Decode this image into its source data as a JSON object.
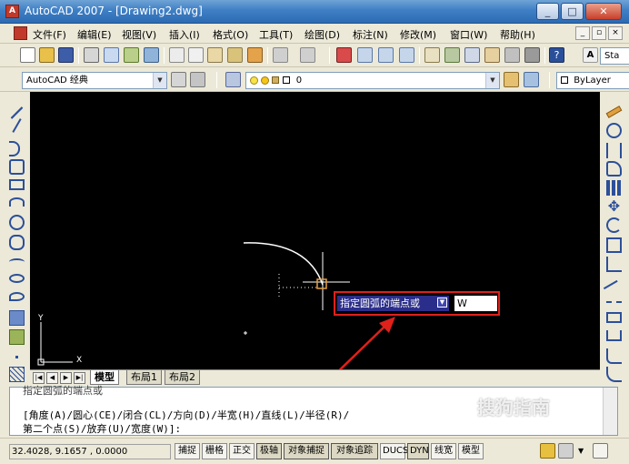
{
  "window": {
    "title": "AutoCAD 2007 - [Drawing2.dwg]",
    "app_icon": "autocad-icon",
    "controls": [
      "_",
      "□",
      "✕"
    ]
  },
  "menu": {
    "items": [
      "文件(F)",
      "编辑(E)",
      "视图(V)",
      "插入(I)",
      "格式(O)",
      "工具(T)",
      "绘图(D)",
      "标注(N)",
      "修改(M)",
      "窗口(W)",
      "帮助(H)"
    ],
    "doc_controls": [
      "_",
      "▫",
      "×"
    ]
  },
  "toolbar1": {
    "text_style_label": "Sta"
  },
  "toolbar2": {
    "workspace": "AutoCAD 经典",
    "layer": "0",
    "color": "ByLayer"
  },
  "canvas": {
    "background": "#000000",
    "tooltip_prompt": "指定圆弧的端点或",
    "tooltip_input": "W",
    "ucs_x": "X",
    "ucs_y": "Y"
  },
  "tabs": {
    "items": [
      "模型",
      "布局1",
      "布局2"
    ],
    "active": "模型"
  },
  "command": {
    "lines": [
      "指定圆弧的端点或",
      "[角度(A)/圆心(CE)/闭合(CL)/方向(D)/半宽(H)/直线(L)/半径(R)/",
      "第二个点(S)/放弃(U)/宽度(W)]:"
    ]
  },
  "status": {
    "coords": "32.4028, 9.1657 , 0.0000",
    "buttons": [
      "捕捉",
      "栅格",
      "正交",
      "极轴",
      "对象捕捉",
      "对象追踪",
      "DUCS",
      "DYN",
      "线宽",
      "模型"
    ]
  },
  "watermark": "搜狗指南"
}
